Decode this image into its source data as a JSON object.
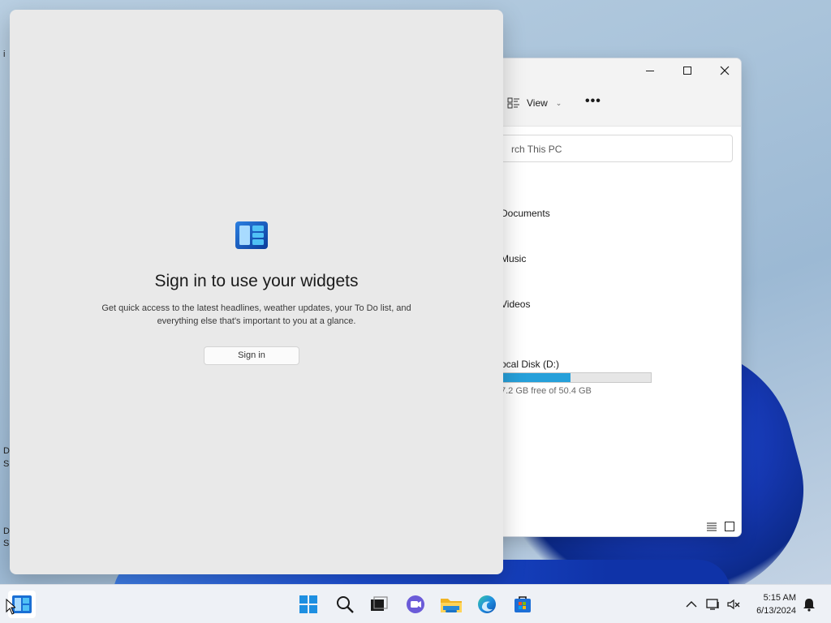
{
  "desktop": {
    "frag_top": "i",
    "frag_d1": "D",
    "frag_s1": "S",
    "frag_d2": "D",
    "frag_s2": "S"
  },
  "explorer": {
    "view_label": "View",
    "more_label": "•••",
    "search_placeholder": "rch This PC",
    "folders": [
      "Documents",
      "Music",
      "Videos"
    ],
    "drive": {
      "name": "ocal Disk (D:)",
      "used_fraction": 0.46,
      "free_text": "7.2 GB free of 50.4 GB"
    }
  },
  "widgets": {
    "title": "Sign in to use your widgets",
    "description": "Get quick access to the latest headlines, weather updates, your To Do list, and everything else that's important to you at a glance.",
    "signin_label": "Sign in"
  },
  "taskbar": {
    "apps": [
      "widgets-icon",
      "start-icon",
      "search-icon",
      "task-view-icon",
      "teams-chat-icon",
      "file-explorer-icon",
      "edge-icon",
      "store-icon"
    ],
    "time": "5:15 AM",
    "date": "6/13/2024"
  },
  "colors": {
    "accent": "#26a0da",
    "taskbar_active": "#1a73c8"
  }
}
